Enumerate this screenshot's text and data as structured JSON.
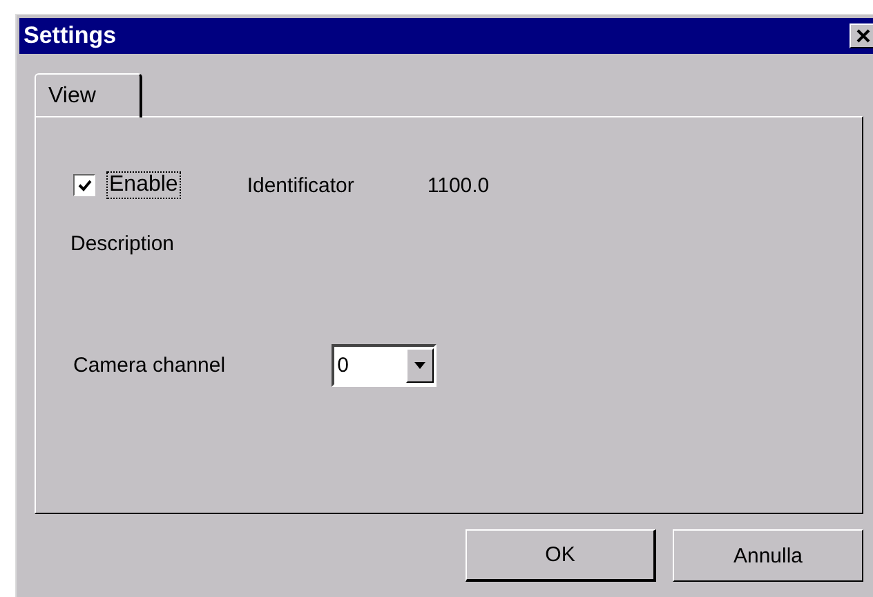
{
  "window": {
    "title": "Settings"
  },
  "tabs": [
    {
      "label": "View",
      "selected": true
    }
  ],
  "enable": {
    "label": "Enable",
    "checked": true
  },
  "identificator": {
    "label": "Identificator",
    "value": "1100.0"
  },
  "description": {
    "label": "Description"
  },
  "camera_channel": {
    "label": "Camera channel",
    "value": "0"
  },
  "buttons": [
    "OK",
    "Annulla"
  ]
}
